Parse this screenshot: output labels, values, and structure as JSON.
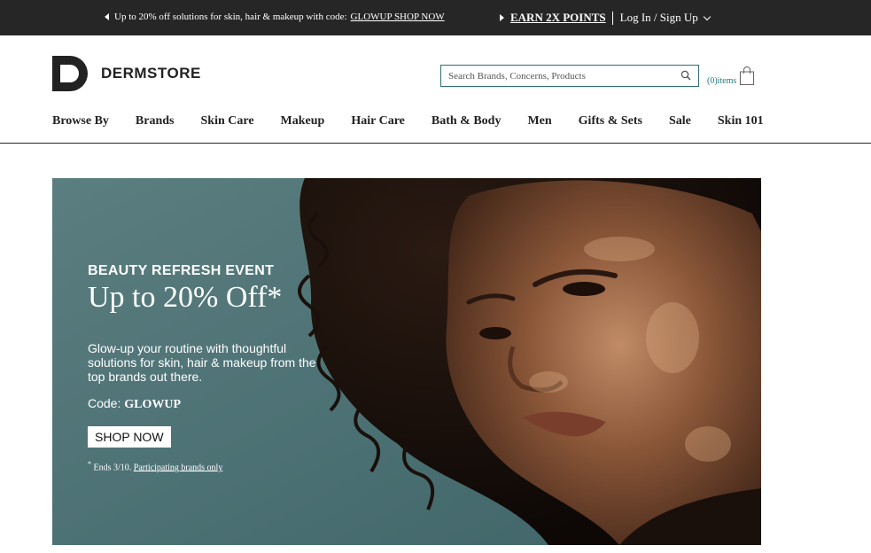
{
  "topbar": {
    "promo_text": "Up to 20% off solutions for skin, hair & makeup with code:",
    "promo_link": "GLOWUP SHOP NOW",
    "earn_points": "EARN 2X POINTS",
    "login": "Log In / Sign Up"
  },
  "header": {
    "brand": "DERMSTORE",
    "search_placeholder": "Search Brands, Concerns, Products",
    "cart_count": "(0)items"
  },
  "nav": {
    "items": [
      "Browse By",
      "Brands",
      "Skin Care",
      "Makeup",
      "Hair Care",
      "Bath & Body",
      "Men",
      "Gifts & Sets",
      "Sale",
      "Skin 101"
    ]
  },
  "hero": {
    "kicker": "BEAUTY REFRESH EVENT",
    "headline": "Up to 20% Off*",
    "description": "Glow-up your routine with thoughtful solutions for skin, hair & makeup from the top brands out there.",
    "code_label": "Code:",
    "code": "GLOWUP",
    "button": "SHOP NOW",
    "fine_mark": "*",
    "fine_text": "Ends 3/10.",
    "fine_link": "Participating brands only"
  },
  "colors": {
    "topbar_bg": "#262626",
    "accent_teal": "#2c6e74",
    "hero_bg": "#4f7476"
  }
}
